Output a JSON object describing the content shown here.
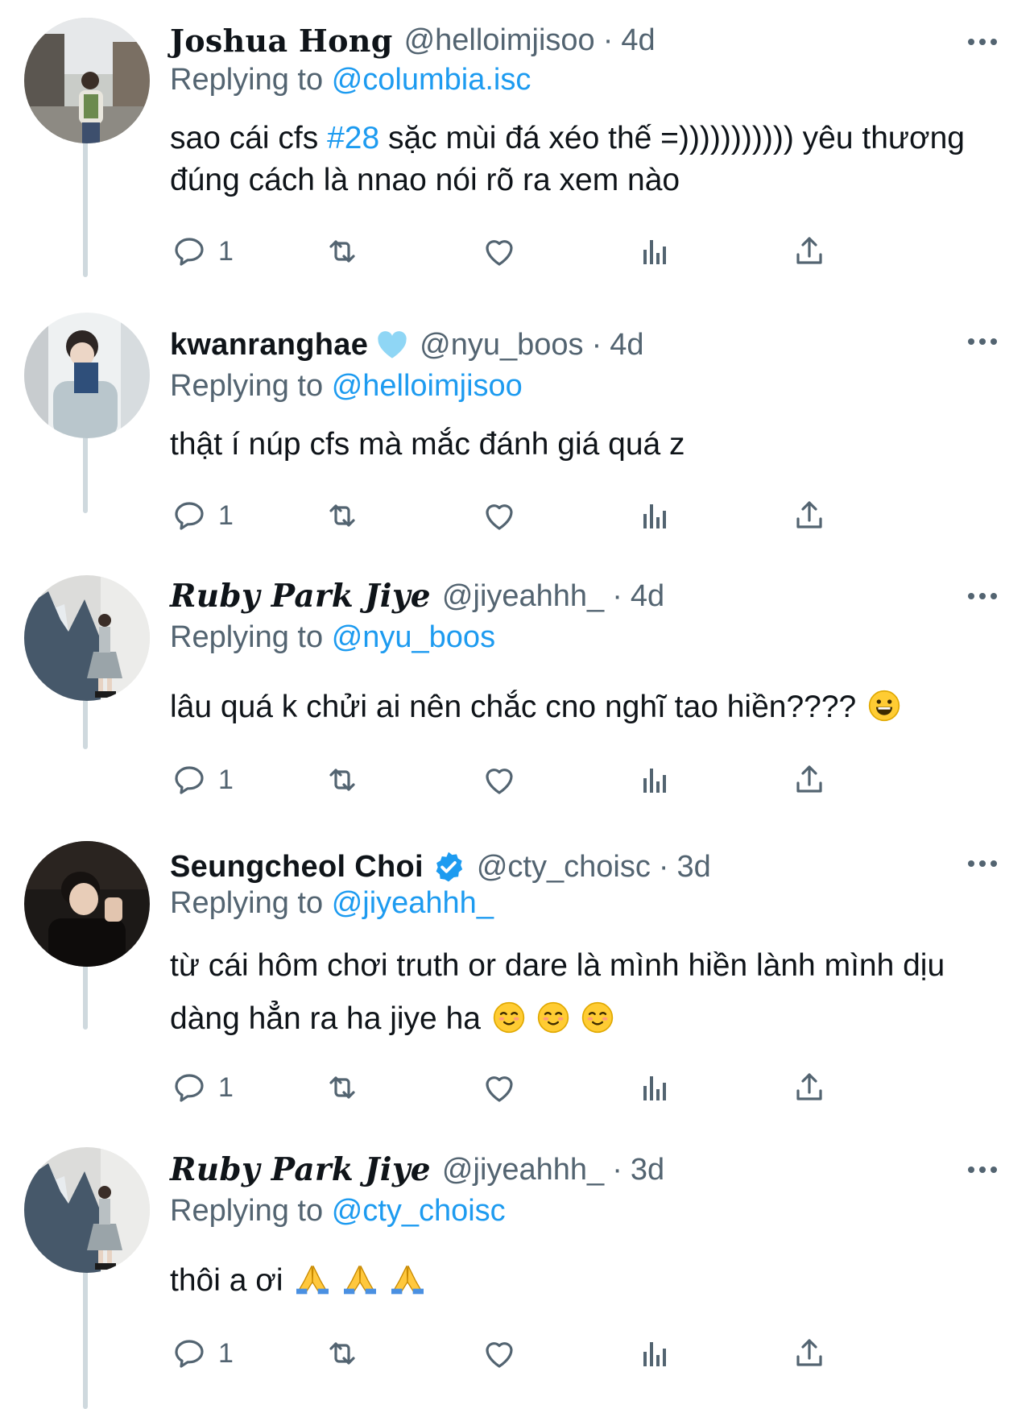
{
  "tweets": [
    {
      "name": "Joshua Hong",
      "handle": "@helloimjisoo",
      "time": "4d",
      "replying_label": "Replying to",
      "replying_to": "@columbia.isc",
      "text_pre": "sao cái cfs ",
      "hashtag": "#28",
      "text_post": " sặc mùi đá xéo thế =))))))))))) yêu thương đúng cách là nnao nói rõ ra xem nào",
      "reply_count": "1"
    },
    {
      "name": "kwanranghae",
      "name_emoji": "light-blue-heart",
      "handle": "@nyu_boos",
      "time": "4d",
      "replying_label": "Replying to",
      "replying_to": "@helloimjisoo",
      "text": "thật í núp cfs mà mắc đánh giá quá z",
      "reply_count": "1"
    },
    {
      "name": "Ruby Park Jiye",
      "handle": "@jiyeahhh_",
      "time": "4d",
      "replying_label": "Replying to",
      "replying_to": "@nyu_boos",
      "text": "lâu quá k chửi ai nên chắc cno nghĩ tao hiền????",
      "text_emoji": "grinning-face",
      "reply_count": "1"
    },
    {
      "name": "Seungcheol Choi",
      "verified": true,
      "handle": "@cty_choisc",
      "time": "3d",
      "replying_label": "Replying to",
      "replying_to": "@jiyeahhh_",
      "text": "từ cái hôm chơi truth or dare là mình hiền lành mình dịu dàng hẳn ra ha jiye ha",
      "text_emoji": "smiling-face x3",
      "reply_count": "1"
    },
    {
      "name": "Ruby Park Jiye",
      "handle": "@jiyeahhh_",
      "time": "3d",
      "replying_label": "Replying to",
      "replying_to": "@cty_choisc",
      "text": "thôi a ơi",
      "text_emoji": "folded-hands x3",
      "reply_count": "1"
    }
  ],
  "colors": {
    "link": "#1d9bf0",
    "secondary": "#536471",
    "text": "#0f1419",
    "thread": "#cfd9de"
  }
}
